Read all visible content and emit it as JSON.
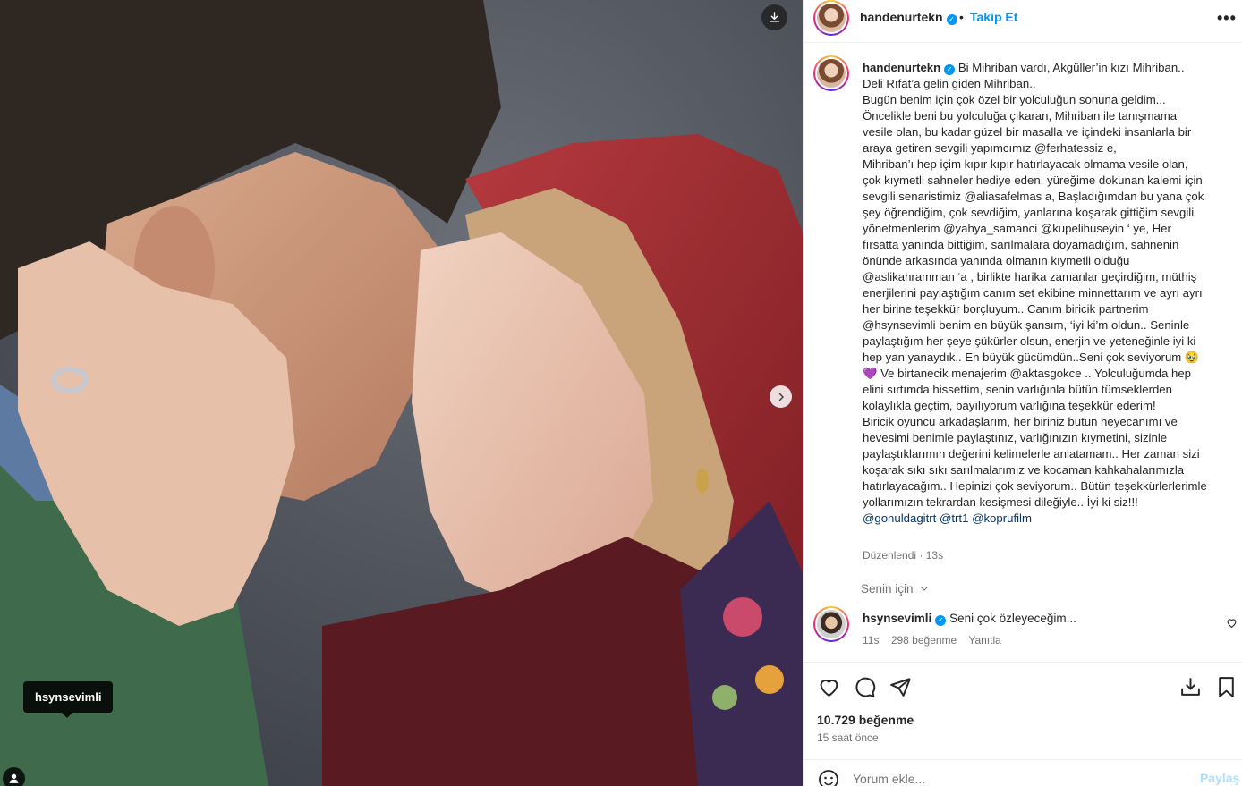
{
  "header": {
    "username": "handenurtekn",
    "dot": "•",
    "follow_label": "Takip Et",
    "more_label": "•••"
  },
  "photo": {
    "tag_label": "hsynsevimli"
  },
  "caption": {
    "author": "handenurtekn",
    "lines": [
      "Bi Mihriban vardı, Akgüller’in kızı Mihriban..",
      "Deli Rıfat’a gelin giden Mihriban..",
      "",
      "Bugün benim için çok özel bir yolculuğun sonuna geldim...",
      "Öncelikle beni bu yolculuğa çıkaran, Mihriban ile tanışmama",
      "vesile olan, bu kadar güzel bir masalla ve içindeki insanlarla bir",
      "araya getiren sevgili yapımcımız @ferhatessiz e,",
      "Mihriban’ı hep içim kıpır kıpır hatırlayacak olmama vesile olan,",
      "çok kıymetli sahneler hediye eden, yüreğime dokunan kalemi için",
      "sevgili senaristimiz @aliasafelmas a, Başladığımdan bu yana çok",
      "şey öğrendiğim, çok sevdiğim, yanlarına koşarak gittiğim sevgili",
      "yönetmenlerim @yahya_samanci @kupelihuseyin ‘ ye, Her",
      "fırsatta yanında bittiğim, sarılmalara doyamadığım, sahnenin",
      "önünde arkasında yanında olmanın kıymetli olduğu",
      "@aslikahramman ‘a , birlikte harika zamanlar geçirdiğim, müthiş",
      "enerjilerini paylaştığım canım set ekibine minnettarım ve ayrı ayrı",
      "her birine teşekkür borçluyum.. Canım biricik partnerim",
      "@hsynsevimli benim en büyük şansım, ‘iyi ki’m oldun.. Seninle",
      "paylaştığım her şeye şükürler olsun, enerjin ve yeteneğinle iyi ki",
      "hep yan yanaydık.. En büyük gücümdün..Seni çok seviyorum 🥹",
      "💜 Ve birtanecik menajerim @aktasgokce .. Yolculuğumda hep",
      "elini sırtımda hissettim, senin varlığınla bütün tümseklerden",
      "kolaylıkla geçtim, bayılıyorum varlığına teşekkür ederim!",
      "Biricik oyuncu arkadaşlarım, her biriniz bütün heyecanımı ve",
      "hevesimi benimle paylaştınız, varlığınızın kıymetini, sizinle",
      "paylaştıklarımın değerini kelimelerle anlatamam.. Her zaman sizi",
      "koşarak sıkı sıkı sarılmalarımız ve kocaman kahkahalarımızla",
      "hatırlayacağım.. Hepinizi çok seviyorum.. Bütün teşekkürlerlerimle",
      "yollarımızın tekrardan kesişmesi dileğiyle.. İyi ki siz!!!",
      "@gonuldagitrt @trt1 @koprufilm"
    ],
    "edited": "Düzenlendi",
    "edited_sep": " · ",
    "edited_time": "13s"
  },
  "for_you": "Senin için",
  "comment": {
    "username": "hsynsevimli",
    "text": "Seni çok özleyeceğim...",
    "time": "11s",
    "likes": "298 beğenme",
    "reply": "Yanıtla"
  },
  "post": {
    "likes": "10.729 beğenme",
    "time_ago": "15 saat önce"
  },
  "add_comment": {
    "placeholder": "Yorum ekle...",
    "post_label": "Paylaş"
  },
  "colors": {
    "accent": "#0095f6",
    "mention": "#00376b",
    "muted": "#737373"
  }
}
